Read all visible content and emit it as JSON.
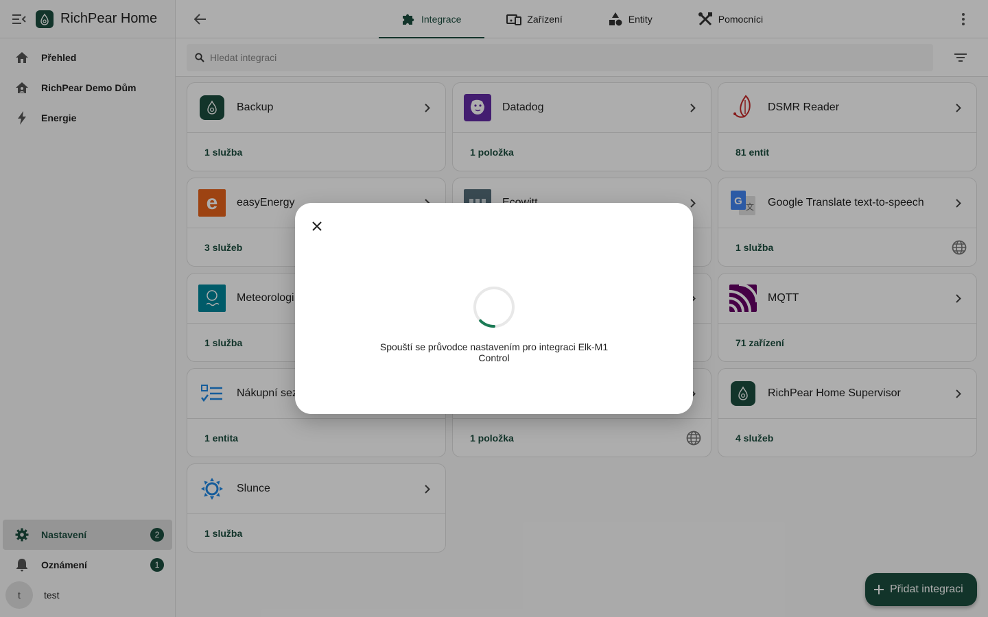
{
  "app": {
    "title": "RichPear Home"
  },
  "sidebar": {
    "items": [
      {
        "label": "Přehled",
        "icon": "home-icon"
      },
      {
        "label": "RichPear Demo Dům",
        "icon": "home-account-icon"
      },
      {
        "label": "Energie",
        "icon": "lightning-icon"
      }
    ],
    "settings": {
      "label": "Nastavení",
      "badge": "2"
    },
    "notifications": {
      "label": "Oznámení",
      "badge": "1"
    },
    "user": {
      "initial": "t",
      "name": "test"
    }
  },
  "tabs": [
    {
      "label": "Integrace",
      "icon": "puzzle-icon"
    },
    {
      "label": "Zařízení",
      "icon": "devices-icon"
    },
    {
      "label": "Entity",
      "icon": "shapes-icon"
    },
    {
      "label": "Pomocníci",
      "icon": "tools-icon"
    }
  ],
  "search": {
    "placeholder": "Hledat integraci"
  },
  "cards": [
    {
      "name": "Backup",
      "count": "1 služba",
      "cloud": false,
      "color": "#1b4d3e"
    },
    {
      "name": "Datadog",
      "count": "1 položka",
      "cloud": false,
      "color": "#632ca6"
    },
    {
      "name": "DSMR Reader",
      "count": "81 entit",
      "cloud": false,
      "color": "#c62828"
    },
    {
      "name": "easyEnergy",
      "count": "3 služeb",
      "cloud": false,
      "color": "#e8641b"
    },
    {
      "name": "Ecowitt",
      "count": "",
      "cloud": false,
      "color": "#546e7a"
    },
    {
      "name": "Google Translate text-to-speech",
      "count": "1 služba",
      "cloud": true,
      "color": "#4285f4"
    },
    {
      "name": "Meteorologi",
      "count": "1 služba",
      "cloud": false,
      "color": "#00879b"
    },
    {
      "name": "",
      "count": "",
      "cloud": false,
      "color": "#999999"
    },
    {
      "name": "MQTT",
      "count": "71 zařízení",
      "cloud": false,
      "color": "#660066"
    },
    {
      "name": "Nákupní sez",
      "count": "1 entita",
      "cloud": false,
      "color": "#1e88e5"
    },
    {
      "name": "",
      "count": "1 položka",
      "cloud": true,
      "color": "#999999"
    },
    {
      "name": "RichPear Home Supervisor",
      "count": "4 služeb",
      "cloud": false,
      "color": "#1b4d3e"
    },
    {
      "name": "Slunce",
      "count": "1 služba",
      "cloud": false,
      "color": "#1e88e5"
    }
  ],
  "dialog": {
    "message": "Spouští se průvodce nastavením pro integraci Elk-M1 Control"
  },
  "fab": {
    "label": "Přidat integraci"
  },
  "colors": {
    "primary": "#1b4d3e",
    "background": "#fafafa"
  }
}
